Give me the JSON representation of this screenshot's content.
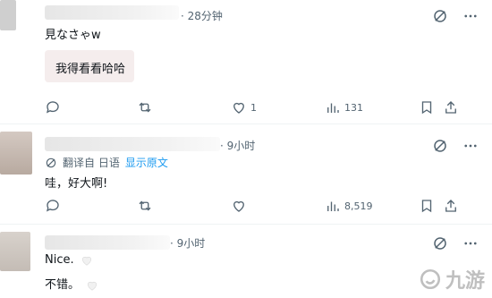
{
  "tweets": [
    {
      "time": "· 28分钟",
      "text": "見なさゃw",
      "translation": "我得看看哈哈",
      "stats": {
        "reply": "",
        "retweet": "",
        "like": "1",
        "views": "131"
      }
    },
    {
      "time": "· 9小时",
      "translate_label": "翻译自 日语",
      "show_original": "显示原文",
      "text": "哇，好大啊!",
      "stats": {
        "reply": "",
        "retweet": "",
        "like": "",
        "views": "8,519"
      }
    },
    {
      "time": "· 9小时",
      "line1": "Nice.",
      "line2": "不错。"
    }
  ],
  "icons": {
    "grok": "grok-icon",
    "more": "more-icon",
    "reply": "reply-icon",
    "retweet": "retweet-icon",
    "like": "heart-icon",
    "views": "views-icon",
    "bookmark": "bookmark-icon",
    "share": "share-icon"
  },
  "watermark": {
    "text": "九游"
  },
  "colors": {
    "text": "#0f1419",
    "secondary": "#536471",
    "link": "#1d9bf0"
  }
}
